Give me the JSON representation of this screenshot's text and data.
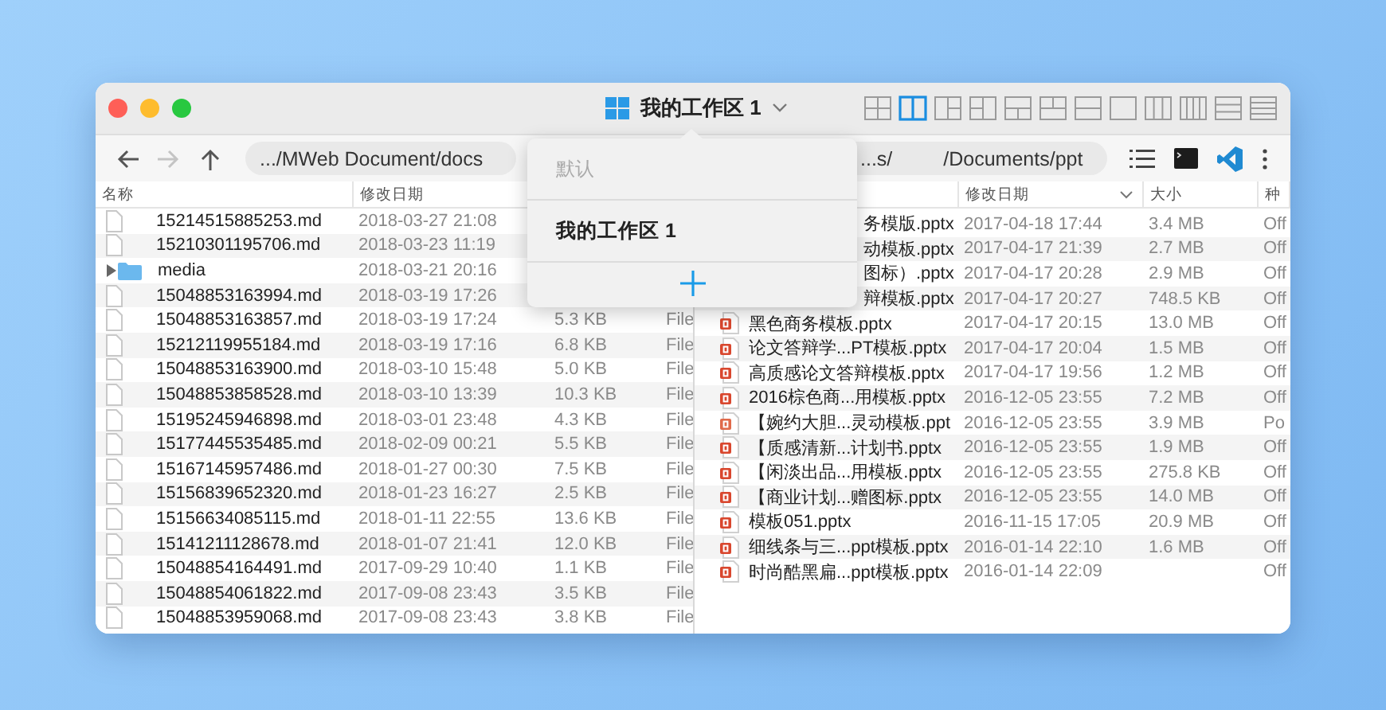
{
  "window": {
    "title": "我的工作区 1"
  },
  "layouts": [
    {
      "kind": "quad",
      "selected": false
    },
    {
      "kind": "cols2",
      "selected": true
    },
    {
      "kind": "split-right",
      "selected": false
    },
    {
      "kind": "split-left",
      "selected": false
    },
    {
      "kind": "split-bottom",
      "selected": false
    },
    {
      "kind": "split-top",
      "selected": false
    },
    {
      "kind": "rows2",
      "selected": false
    },
    {
      "kind": "single",
      "selected": false
    },
    {
      "kind": "cols3",
      "selected": false
    },
    {
      "kind": "cols4",
      "selected": false
    },
    {
      "kind": "rows3",
      "selected": false
    },
    {
      "kind": "rows4",
      "selected": false
    }
  ],
  "left_pane": {
    "nav": [
      {
        "kind": "back",
        "disabled": false
      },
      {
        "kind": "forward",
        "disabled": true
      },
      {
        "kind": "up",
        "disabled": false
      }
    ],
    "path": ".../MWeb Document/docs",
    "headers": {
      "name": {
        "label": "名称",
        "sorted": false
      },
      "date": {
        "label": "修改日期",
        "sorted": false
      }
    },
    "rows": [
      {
        "kind": "md",
        "name": "15214515885253.md",
        "date": "2018-03-27 21:08"
      },
      {
        "kind": "md",
        "name": "15210301195706.md",
        "date": "2018-03-23 11:19"
      },
      {
        "kind": "folder",
        "expanded": false,
        "name": "media",
        "date": "2018-03-21 20:16"
      },
      {
        "kind": "md",
        "name": "15048853163994.md",
        "date": "2018-03-19 17:26"
      },
      {
        "kind": "md",
        "name": "15048853163857.md",
        "date": "2018-03-19 17:24",
        "size": "5.3 KB",
        "file_type": "File"
      },
      {
        "kind": "md",
        "name": "15212119955184.md",
        "date": "2018-03-19 17:16",
        "size": "6.8 KB",
        "file_type": "File"
      },
      {
        "kind": "md",
        "name": "15048853163900.md",
        "date": "2018-03-10 15:48",
        "size": "5.0 KB",
        "file_type": "File"
      },
      {
        "kind": "md",
        "name": "15048853858528.md",
        "date": "2018-03-10 13:39",
        "size": "10.3 KB",
        "file_type": "File"
      },
      {
        "kind": "md",
        "name": "15195245946898.md",
        "date": "2018-03-01 23:48",
        "size": "4.3 KB",
        "file_type": "File"
      },
      {
        "kind": "md",
        "name": "15177445535485.md",
        "date": "2018-02-09 00:21",
        "size": "5.5 KB",
        "file_type": "File"
      },
      {
        "kind": "md",
        "name": "15167145957486.md",
        "date": "2018-01-27 00:30",
        "size": "7.5 KB",
        "file_type": "File"
      },
      {
        "kind": "md",
        "name": "15156839652320.md",
        "date": "2018-01-23 16:27",
        "size": "2.5 KB",
        "file_type": "File"
      },
      {
        "kind": "md",
        "name": "15156634085115.md",
        "date": "2018-01-11 22:55",
        "size": "13.6 KB",
        "file_type": "File"
      },
      {
        "kind": "md",
        "name": "15141211128678.md",
        "date": "2018-01-07 21:41",
        "size": "12.0 KB",
        "file_type": "File"
      },
      {
        "kind": "md",
        "name": "15048854164491.md",
        "date": "2017-09-29 10:40",
        "size": "1.1 KB",
        "file_type": "File"
      },
      {
        "kind": "md",
        "name": "15048854061822.md",
        "date": "2017-09-08 23:43",
        "size": "3.5 KB",
        "file_type": "File"
      },
      {
        "kind": "md",
        "name": "15048853959068.md",
        "date": "2017-09-08 23:43",
        "size": "3.8 KB",
        "file_type": "File"
      }
    ]
  },
  "right_pane": {
    "path_parts": [
      "...s/",
      "/Documents/ppt"
    ],
    "tools": [
      {
        "kind": "list"
      },
      {
        "kind": "terminal"
      },
      {
        "kind": "editor"
      },
      {
        "kind": "more"
      }
    ],
    "headers": {
      "date": {
        "label": "修改日期",
        "sorted": true
      },
      "size": {
        "label": "大小",
        "sorted": false
      },
      "kind": {
        "label": "种"
      }
    },
    "rows": [
      {
        "kind": "covered",
        "name": "务模版.pptx",
        "date": "2017-04-18 17:44",
        "size": "3.4 MB",
        "file_type": "Off"
      },
      {
        "kind": "covered",
        "name": "动模板.pptx",
        "date": "2017-04-17 21:39",
        "size": "2.7 MB",
        "file_type": "Off"
      },
      {
        "kind": "covered",
        "name": "图标）.pptx",
        "date": "2017-04-17 20:28",
        "size": "2.9 MB",
        "file_type": "Off"
      },
      {
        "kind": "covered",
        "name": "辩模板.pptx",
        "date": "2017-04-17 20:27",
        "size": "748.5 KB",
        "file_type": "Off"
      },
      {
        "kind": "pptx",
        "name": "黑色商务模板.pptx",
        "date": "2017-04-17 20:15",
        "size": "13.0 MB",
        "file_type": "Off"
      },
      {
        "kind": "pptx",
        "name": "论文答辩学...PT模板.pptx",
        "date": "2017-04-17 20:04",
        "size": "1.5 MB",
        "file_type": "Off"
      },
      {
        "kind": "pptx",
        "name": "高质感论文答辩模板.pptx",
        "date": "2017-04-17 19:56",
        "size": "1.2 MB",
        "file_type": "Off"
      },
      {
        "kind": "pptx",
        "name": "2016棕色商...用模板.pptx",
        "date": "2016-12-05 23:55",
        "size": "7.2 MB",
        "file_type": "Off"
      },
      {
        "kind": "ppt",
        "name": "【婉约大胆...灵动模板.ppt",
        "date": "2016-12-05 23:55",
        "size": "3.9 MB",
        "file_type": "Po"
      },
      {
        "kind": "pptx",
        "name": "【质感清新...计划书.pptx",
        "date": "2016-12-05 23:55",
        "size": "1.9 MB",
        "file_type": "Off"
      },
      {
        "kind": "pptx",
        "name": "【闲淡出品...用模板.pptx",
        "date": "2016-12-05 23:55",
        "size": "275.8 KB",
        "file_type": "Off"
      },
      {
        "kind": "pptx",
        "name": "【商业计划...赠图标.pptx",
        "date": "2016-12-05 23:55",
        "size": "14.0 MB",
        "file_type": "Off"
      },
      {
        "kind": "pptx",
        "name": "模板051.pptx",
        "date": "2016-11-15 17:05",
        "size": "20.9 MB",
        "file_type": "Off"
      },
      {
        "kind": "pptx",
        "name": "细线条与三...ppt模板.pptx",
        "date": "2016-01-14 22:10",
        "size": "1.6 MB",
        "file_type": "Off"
      },
      {
        "kind": "pptx",
        "name": "时尚酷黑扁...ppt模板.pptx",
        "date": "2016-01-14 22:09",
        "file_type": "Off"
      }
    ]
  },
  "workspace_menu": {
    "items": [
      {
        "label": "默认",
        "selected": false
      },
      {
        "label": "我的工作区 1",
        "selected": true
      }
    ]
  }
}
